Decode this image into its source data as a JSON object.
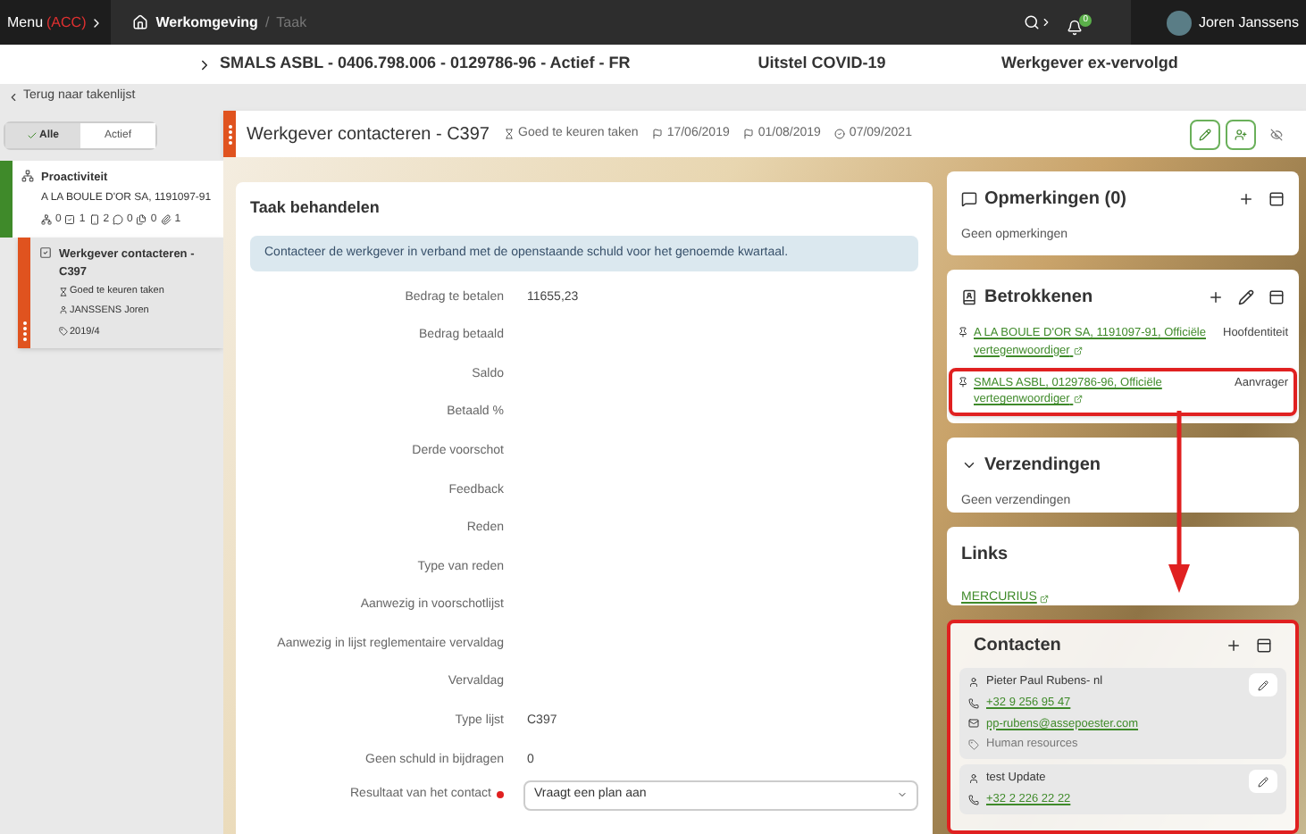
{
  "topbar": {
    "menu": "Menu",
    "env": "(ACC)",
    "breadcrumb": [
      "Werkomgeving",
      "Taak"
    ],
    "breadcrumb_separator": "/",
    "notifications": "0",
    "user": "Joren Janssens"
  },
  "entity_bar": {
    "title": "SMALS ASBL - 0406.798.006 - 0129786-96 - Actief - FR",
    "items": [
      "Uitstel COVID-19",
      "Werkgever ex-vervolgd"
    ]
  },
  "back_link": "Terug naar takenlijst",
  "filter_tabs": [
    {
      "label": "Alle",
      "selected": true
    },
    {
      "label": "Actief",
      "selected": false
    }
  ],
  "task_list": [
    {
      "kind": "activity",
      "title": "Proactiviteit",
      "subtitle": "A LA BOULE D'OR SA, 1191097-91",
      "counts": [
        "0",
        "1",
        "2",
        "0",
        "0",
        "1"
      ],
      "color": "#3f8a2a",
      "selected": false
    },
    {
      "kind": "task",
      "title": "Werkgever contacteren - C397",
      "status": "Goed te keuren taken",
      "assignee": "JANSSENS Joren",
      "tag": "2019/4",
      "color": "#e0531f",
      "selected": true
    }
  ],
  "task_header": {
    "title": "Werkgever contacteren - C397",
    "status": "Goed te keuren taken",
    "dates": [
      {
        "kind": "start",
        "text": "17/06/2019"
      },
      {
        "kind": "due",
        "text": "01/08/2019"
      },
      {
        "kind": "done",
        "text": "07/09/2021"
      }
    ]
  },
  "form": {
    "title": "Taak behandelen",
    "notice": "Contacteer de werkgever in verband met de openstaande schuld voor het genoemde kwartaal.",
    "fields": [
      {
        "label": "Bedrag te betalen",
        "value": "11655,23"
      },
      {
        "label": "Bedrag betaald"
      },
      {
        "label": "Saldo"
      },
      {
        "label": "Betaald %"
      },
      {
        "label": "Derde voorschot"
      },
      {
        "label": "Feedback"
      },
      {
        "label": "Reden"
      },
      {
        "label": "Type van reden"
      },
      {
        "label": "Aanwezig in voorschotlijst"
      },
      {
        "label": "Aanwezig in lijst reglementaire vervaldag"
      },
      {
        "label": "Vervaldag"
      },
      {
        "label": "Type lijst",
        "value": "C397"
      },
      {
        "label": "Geen schuld in bijdragen",
        "value": "0"
      }
    ],
    "result": {
      "label": "Resultaat van het contact",
      "required": true,
      "value": "Vraagt een plan aan"
    }
  },
  "remarks": {
    "title": "Opmerkingen (0)",
    "empty": "Geen opmerkingen"
  },
  "involved": {
    "title": "Betrokkenen",
    "items": [
      {
        "name": "A LA BOULE D'OR SA, 1191097-91, Officiële vertegenwoordiger",
        "role": "Hoofdentiteit",
        "annotated": false
      },
      {
        "name": "SMALS ASBL, 0129786-96, Officiële vertegenwoordiger",
        "role": "Aanvrager",
        "annotated": true
      }
    ]
  },
  "shipments": {
    "title": "Verzendingen",
    "empty": "Geen verzendingen"
  },
  "links": {
    "title": "Links",
    "items": [
      "MERCURIUS"
    ]
  },
  "contacts": {
    "title": "Contacten",
    "annotated": true,
    "items": [
      {
        "name": "Pieter Paul Rubens- nl",
        "phone": "+32 9 256 95 47",
        "email": "pp-rubens@assepoester.com",
        "department": "Human resources"
      },
      {
        "name": "test Update",
        "phone": "+32 2 226 22 22"
      }
    ]
  }
}
